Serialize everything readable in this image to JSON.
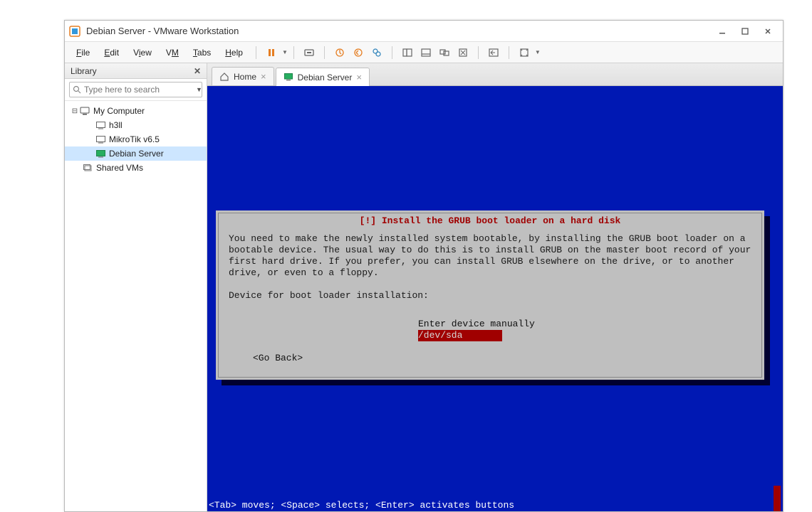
{
  "window": {
    "title": "Debian Server - VMware Workstation"
  },
  "menu": {
    "file": "File",
    "edit": "Edit",
    "view": "View",
    "vm": "VM",
    "tabs": "Tabs",
    "help": "Help"
  },
  "sidebar": {
    "title": "Library",
    "search_placeholder": "Type here to search",
    "tree": {
      "root_label": "My Computer",
      "items": [
        {
          "label": "h3ll"
        },
        {
          "label": "MikroTik v6.5"
        },
        {
          "label": "Debian Server"
        }
      ],
      "shared_label": "Shared VMs"
    }
  },
  "tabs": [
    {
      "label": "Home",
      "icon": "home"
    },
    {
      "label": "Debian Server",
      "icon": "vm"
    }
  ],
  "installer": {
    "title": "[!] Install the GRUB boot loader on a hard disk",
    "body": "You need to make the newly installed system bootable, by installing the GRUB boot loader on a bootable device. The usual way to do this is to install GRUB on the master boot record of your first hard drive. If you prefer, you can install GRUB elsewhere on the drive, or to another drive, or even to a floppy.\n\nDevice for boot loader installation:",
    "options": [
      "Enter device manually",
      "/dev/sda"
    ],
    "selected_index": 1,
    "go_back_label": "<Go Back>",
    "footer_hint": "<Tab> moves; <Space> selects; <Enter> activates buttons"
  }
}
